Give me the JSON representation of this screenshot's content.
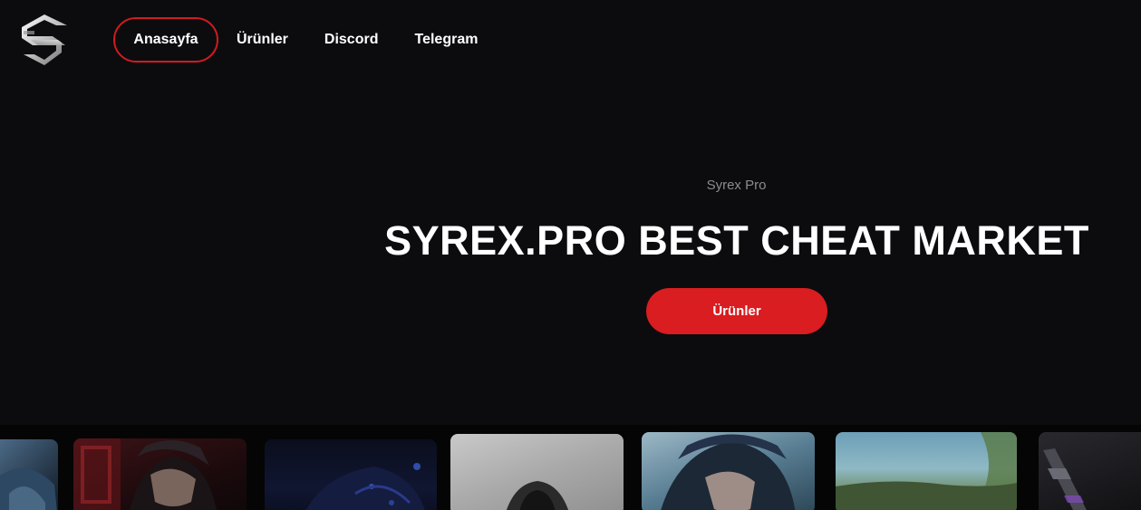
{
  "header": {
    "logo_icon": "syrex-s-logo-icon",
    "nav": [
      {
        "label": "Anasayfa",
        "active": true
      },
      {
        "label": "Ürünler",
        "active": false
      },
      {
        "label": "Discord",
        "active": false
      },
      {
        "label": "Telegram",
        "active": false
      }
    ]
  },
  "hero": {
    "subtitle": "Syrex Pro",
    "title": "SYREX.PRO BEST CHEAT MARKET",
    "button_label": "Ürünler"
  },
  "colors": {
    "background": "#0c0c0e",
    "accent": "#d91d20",
    "text": "#ffffff",
    "muted": "#8c8c8c"
  },
  "product_strip": {
    "card_count": 7
  }
}
